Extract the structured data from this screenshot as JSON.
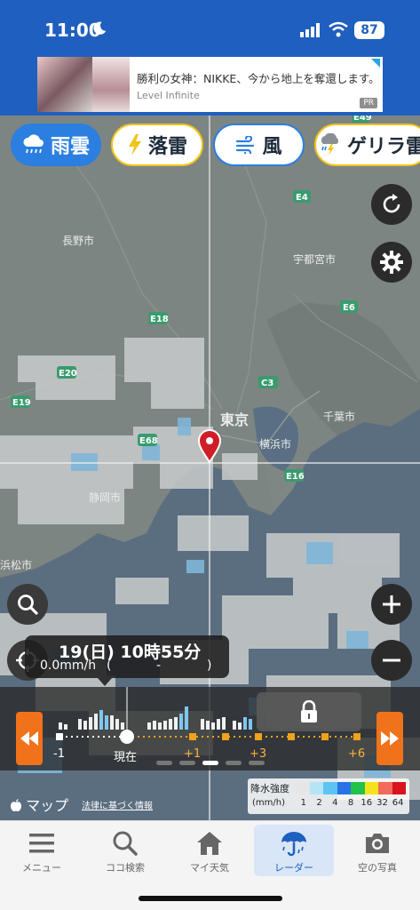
{
  "status": {
    "time": "11:00",
    "battery": "87"
  },
  "ad": {
    "title": "勝利の女神：NIKKE、今から地上を奪還します。",
    "source": "Level Infinite",
    "badge": "PR"
  },
  "layers": {
    "tabs": [
      {
        "label": "雨雲",
        "icon": "rain-cloud-icon",
        "active": true
      },
      {
        "label": "落雷",
        "icon": "lightning-icon",
        "active": false
      },
      {
        "label": "風",
        "icon": "wind-icon",
        "active": false
      },
      {
        "label": "ゲリラ雷",
        "icon": "storm-cloud-icon",
        "active": false
      }
    ]
  },
  "map": {
    "place_labels": [
      "長野市",
      "宇都宮市",
      "東京",
      "横浜市",
      "千葉市",
      "静岡市",
      "浜松市"
    ],
    "road_labels": [
      "E49",
      "E4",
      "E6",
      "E18",
      "E20",
      "E19",
      "C3",
      "E68",
      "E16"
    ]
  },
  "time_bubble": {
    "datetime": "19(日) 10時55分",
    "rate": "0.0mm/h",
    "open_paren": "(",
    "middle": "-",
    "close_paren": ")"
  },
  "timeline": {
    "labels": {
      "minus1": "-1",
      "now": "現在",
      "plus1": "+1",
      "plus3": "+3",
      "plus6": "+6"
    },
    "page_count": 5,
    "active_page": 3
  },
  "map_footer": {
    "maps_logo": "マップ",
    "legal": "法律に基づく情報"
  },
  "legend": {
    "title": "降水強度",
    "unit": "(mm/h)",
    "values": [
      "1",
      "2",
      "4",
      "8",
      "16",
      "32",
      "64"
    ],
    "colors": [
      "#e6e6e6",
      "#b3e5f7",
      "#5cc4f2",
      "#2a72e6",
      "#22c34a",
      "#f5e31a",
      "#f26a5a",
      "#d9141c"
    ]
  },
  "nav": {
    "items": [
      {
        "label": "メニュー",
        "icon": "menu-icon"
      },
      {
        "label": "ココ検索",
        "icon": "search-icon"
      },
      {
        "label": "マイ天気",
        "icon": "home-icon"
      },
      {
        "label": "レーダー",
        "icon": "umbrella-icon"
      },
      {
        "label": "空の写真",
        "icon": "camera-icon"
      }
    ],
    "active_index": 3
  },
  "colors": {
    "header": "#1f5fbf",
    "accent": "#2a7fe0",
    "orange": "#f0721a",
    "yellow": "#f0c419"
  }
}
